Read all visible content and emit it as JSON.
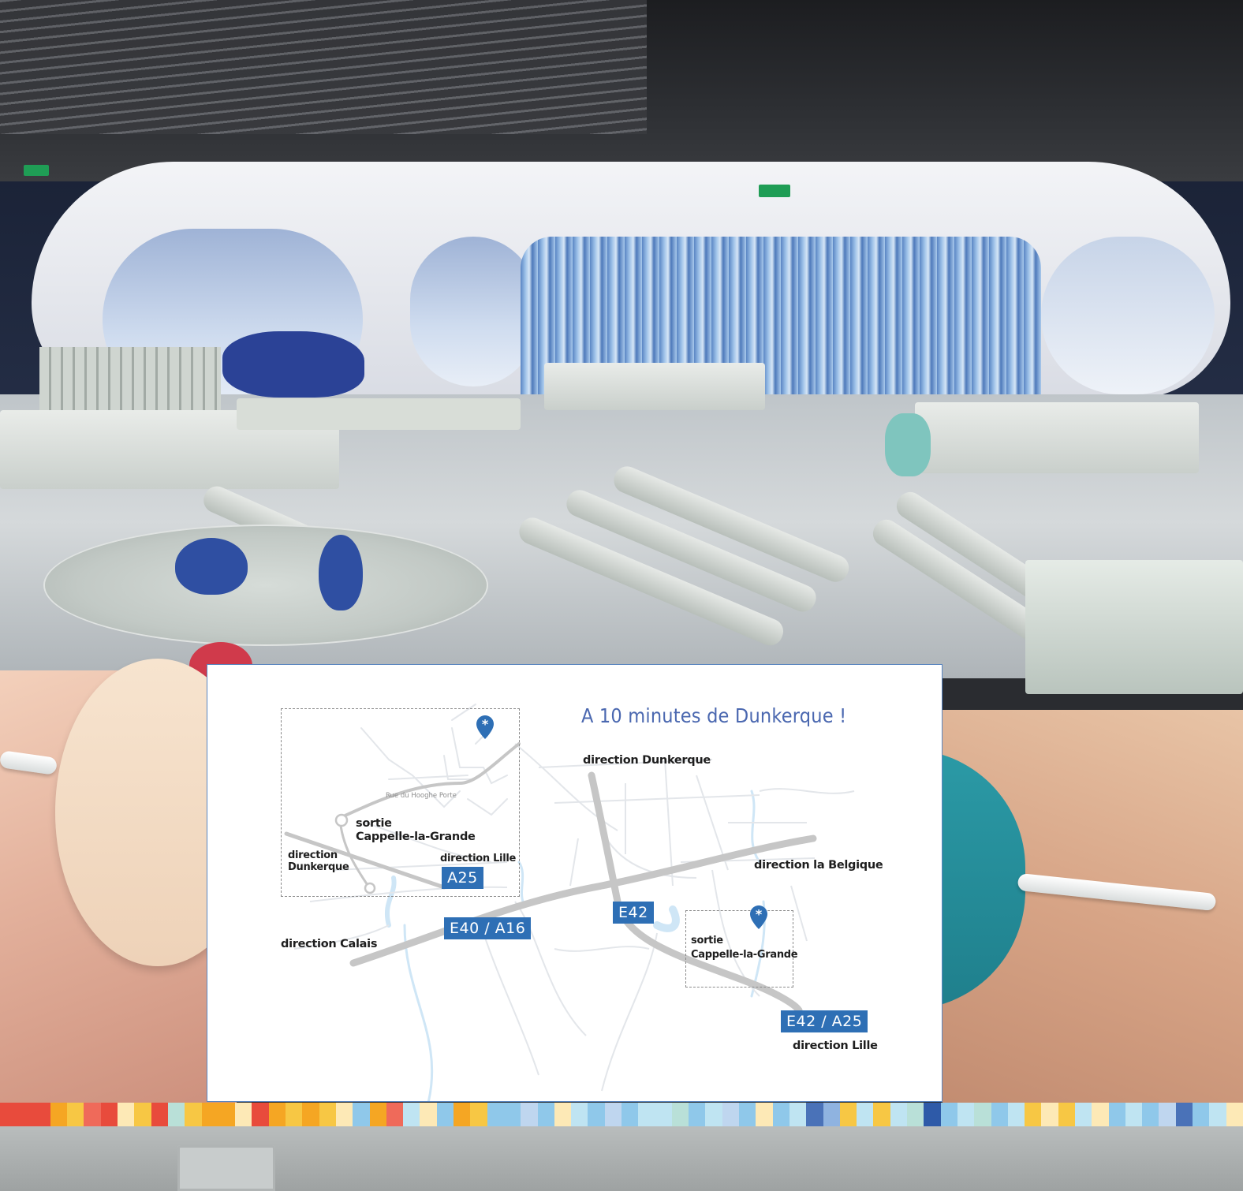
{
  "map": {
    "title": "A 10 minutes de Dunkerque !",
    "labels": {
      "direction_dunkerque_top": "direction Dunkerque",
      "direction_belgique": "direction la Belgique",
      "direction_calais": "direction Calais",
      "direction_lille_bottom": "direction Lille",
      "sortie_main": "sortie",
      "cappelle_main": "Cappelle-la-Grande",
      "inset_sortie": "sortie",
      "inset_cappelle": "Cappelle-la-Grande",
      "inset_direction": "direction",
      "inset_dunkerque": "Dunkerque",
      "inset_direction_lille": "direction Lille",
      "inset_street": "Rue du Hooghe Porte"
    },
    "roads": {
      "e40_a16": "E40 / A16",
      "e42": "E42",
      "e42_a25": "E42 / A25",
      "a25": "A25"
    },
    "colors": {
      "title": "#4b68b0",
      "badge": "#2e6fb5",
      "pin": "#2e6fb5",
      "motorway": "#c6c6c6",
      "minor_road": "#e3e6ea",
      "water": "#cfe6f6"
    },
    "icons": [
      "location-pin-icon"
    ]
  },
  "strip_colors": [
    "#e84b3c",
    "#e84b3c",
    "#e84b3c",
    "#f5a623",
    "#f7c744",
    "#ef6a5a",
    "#e84b3c",
    "#fde9b6",
    "#f7c744",
    "#e84b3c",
    "#b9e0d8",
    "#f7c744",
    "#f5a623",
    "#f5a623",
    "#fde9b6",
    "#e84b3c",
    "#f5a623",
    "#f7c744",
    "#f5a623",
    "#f7c744",
    "#fde9b6",
    "#8fc8ea",
    "#f5a623",
    "#ef6a5a",
    "#bfe4f2",
    "#fde9b6",
    "#8fc8ea",
    "#f5a623",
    "#f7c744",
    "#8fc8ea",
    "#8fc8ea",
    "#bfd6ef",
    "#8fc8ea",
    "#fde9b6",
    "#bfe4f2",
    "#8fc8ea",
    "#bfd6ef",
    "#8fc8ea",
    "#bfe4f2",
    "#bfe4f2",
    "#b9e0d8",
    "#8fc8ea",
    "#bfe4f2",
    "#bfd6ef",
    "#8fc8ea",
    "#fde9b6",
    "#8fc8ea",
    "#bfe4f2",
    "#4a72b8",
    "#8fb3e0",
    "#f7c744",
    "#bfe4f2",
    "#f7c744",
    "#bfe4f2",
    "#b9e0d8",
    "#2e5aa8",
    "#8fc8ea",
    "#bfe4f2",
    "#b9e0d8",
    "#8fc8ea",
    "#bfe4f2",
    "#f7c744",
    "#fde9b6",
    "#f7c744",
    "#bfe4f2",
    "#fde9b6",
    "#8fc8ea",
    "#bfe4f2",
    "#8fc8ea",
    "#bfd6ef",
    "#4a72b8",
    "#8fc8ea",
    "#bfe4f2",
    "#fde9b6"
  ]
}
